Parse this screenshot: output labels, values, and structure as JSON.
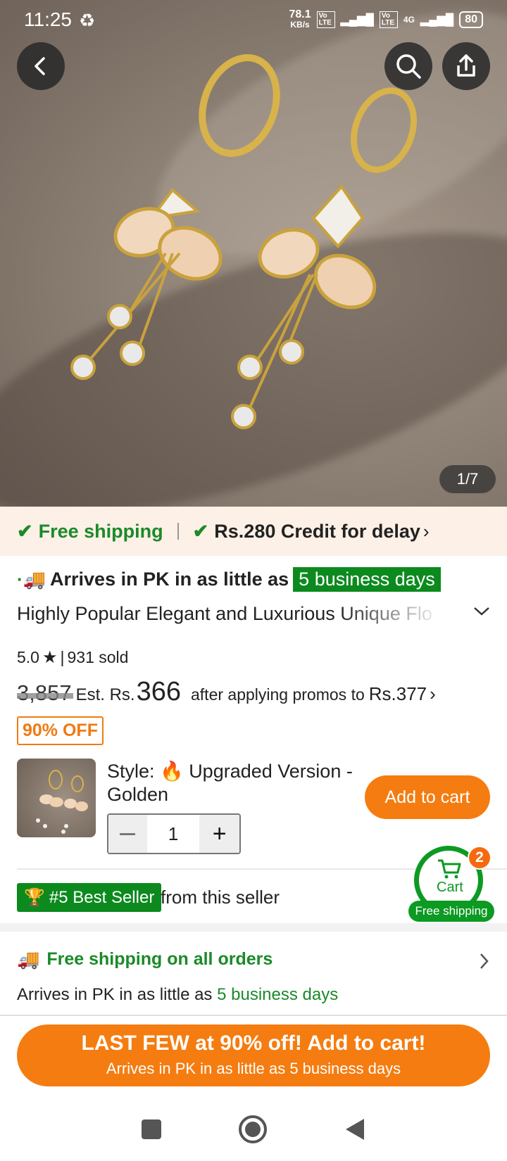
{
  "status_bar": {
    "time": "11:25",
    "net_speed": "78.1",
    "net_unit": "KB/s",
    "volte1": "Vo LTE",
    "volte2": "Vo LTE",
    "network": "4G",
    "battery": "80"
  },
  "gallery": {
    "counter": "1/7"
  },
  "shipping_strip": {
    "free_shipping": "Free shipping",
    "credit": "Rs.280 Credit for delay"
  },
  "product": {
    "arrives_prefix": "Arrives in PK in as little as",
    "arrives_days": "5 business days",
    "title": "Highly Popular Elegant and Luxurious Unique Flo",
    "rating": "5.0",
    "sold": "931 sold",
    "old_price": "3,857",
    "est_label": "Est. Rs.",
    "est_price": "366",
    "promo_text": "after applying promos to",
    "promo_price": "Rs.377",
    "discount": "90% OFF",
    "style_label": "Style:",
    "style_value": "Upgraded Version - Golden",
    "quantity": "1",
    "add_to_cart": "Add to cart",
    "best_seller": "#5 Best Seller",
    "from_seller": "from this seller"
  },
  "cart_float": {
    "label": "Cart",
    "count": "2",
    "free_shipping": "Free shipping"
  },
  "shipping_section": {
    "title": "Free shipping on all orders",
    "arrives_prefix": "Arrives in PK in as little as",
    "arrives_days": "5 business days"
  },
  "cta": {
    "title": "LAST FEW at 90% off! Add to cart!",
    "subtitle": "Arrives in PK in as little as 5 business days"
  },
  "colors": {
    "accent_orange": "#f57c10",
    "green": "#1b8a2a",
    "strip_bg": "#fdf0e6"
  }
}
